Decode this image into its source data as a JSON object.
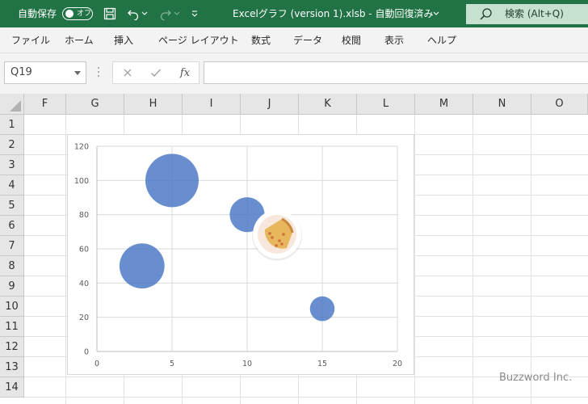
{
  "titlebar": {
    "autosave_label": "自動保存",
    "autosave_state": "オフ",
    "file_title": "Excelグラフ (version 1).xlsb  -  自動回復済み",
    "search_label": "検索 (Alt+Q)"
  },
  "menu": {
    "items": [
      "ファイル",
      "ホーム",
      "挿入",
      "ページ レイアウト",
      "数式",
      "データ",
      "校閲",
      "表示",
      "ヘルプ"
    ]
  },
  "formula_bar": {
    "name_box": "Q19",
    "fx_label": "fx",
    "formula": ""
  },
  "sheet": {
    "columns": [
      "F",
      "G",
      "H",
      "I",
      "J",
      "K",
      "L",
      "M",
      "N",
      "O"
    ],
    "rows": [
      "1",
      "2",
      "3",
      "4",
      "5",
      "6",
      "7",
      "8",
      "9",
      "10",
      "11",
      "12",
      "13",
      "14"
    ]
  },
  "chart_data": {
    "type": "bubble",
    "xlim": [
      0,
      20
    ],
    "ylim": [
      0,
      120
    ],
    "x_ticks": [
      "0",
      "5",
      "10",
      "15",
      "20"
    ],
    "y_ticks": [
      "0",
      "20",
      "40",
      "60",
      "80",
      "100",
      "120"
    ],
    "grid": true,
    "color": "#4472c4",
    "points": [
      {
        "x": 3,
        "y": 50,
        "size": 50
      },
      {
        "x": 5,
        "y": 100,
        "size": 70
      },
      {
        "x": 10,
        "y": 80,
        "size": 30
      },
      {
        "x": 15,
        "y": 25,
        "size": 15
      }
    ],
    "overlay_icon": "pie-slice-icon"
  },
  "watermark": "Buzzword Inc."
}
